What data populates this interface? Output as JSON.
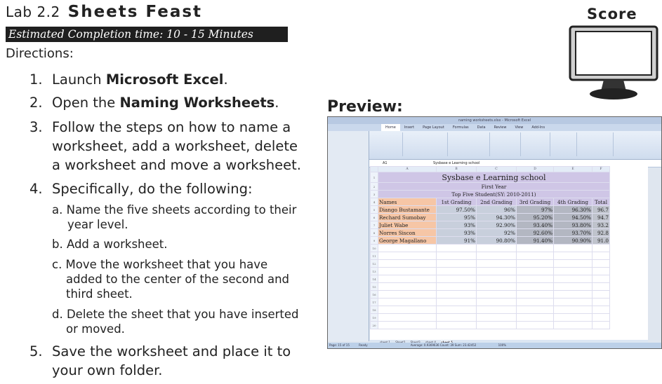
{
  "lab_prefix": "Lab 2.2",
  "lab_title": "Sheets Feast",
  "estimated": "Estimated Completion time: 10 - 15 Minutes",
  "directions_label": "Directions:",
  "steps": [
    {
      "num": "1.",
      "pre": "Launch ",
      "bold": "Microsoft Excel",
      "post": "."
    },
    {
      "num": "2.",
      "pre": "Open the ",
      "bold": "Naming Worksheets",
      "post": "."
    },
    {
      "num": "3.",
      "lines": [
        "Follow the steps on how to name a",
        "worksheet, add a worksheet, delete",
        "a  worksheet and move a worksheet."
      ]
    },
    {
      "num": "4.",
      "text": "Specifically, do the following:"
    },
    {
      "num": "5.",
      "lines": [
        "Save the worksheet and place it to",
        "your own folder."
      ]
    }
  ],
  "substeps": [
    {
      "lines": [
        "a. Name the five sheets according to their",
        "year level."
      ]
    },
    {
      "lines": [
        "b. Add a worksheet."
      ]
    },
    {
      "lines": [
        "c. Move the worksheet that you have",
        "added to the center of the second and",
        "third sheet."
      ]
    },
    {
      "lines": [
        "d. Delete the sheet that you have  inserted",
        "or moved."
      ]
    }
  ],
  "score_label": "Score",
  "preview_label": "Preview:",
  "excel": {
    "window_title": "naming worksheets.xlsx - Microsoft Excel",
    "tabs": [
      "Home",
      "Insert",
      "Page Layout",
      "Formulas",
      "Data",
      "Review",
      "View",
      "Add-Ins"
    ],
    "cell_ref": "A1",
    "formula": "Sysbase e Learning school",
    "columns": [
      "A",
      "B",
      "C",
      "D",
      "E",
      "F"
    ],
    "sheet_title": "Sysbase e Learning school",
    "sheet_subtitle": "First Year",
    "sheet_heading": "Top Five Student(SY: 2010-2011)",
    "headers": [
      "Names",
      "1st Grading",
      "2nd Grading",
      "3rd Grading",
      "4th Grading",
      "Total"
    ],
    "rows": [
      [
        "Diango Bustamante",
        "97.50%",
        "96%",
        "97%",
        "96.30%",
        "96.7"
      ],
      [
        "Rechard Sumobay",
        "95%",
        "94.30%",
        "95.20%",
        "94.50%",
        "94.7"
      ],
      [
        "Juliet Wabe",
        "93%",
        "92.90%",
        "93.40%",
        "93.80%",
        "93.2"
      ],
      [
        "Norres Siscon",
        "93%",
        "92%",
        "92.60%",
        "93.70%",
        "92.8"
      ],
      [
        "George Magallano",
        "91%",
        "90.80%",
        "91.40%",
        "90.90%",
        "91.0"
      ]
    ],
    "sheet_tabs": [
      "sheet 1",
      "Sheet2",
      "Sheet3",
      "sheet 4",
      "sheet 5"
    ],
    "status_ready": "Ready",
    "status_page": "Page: 15 of 15",
    "status_stats": "Average: 0.9369636   Count: 39   Sum: 23.42452",
    "zoom": "100%"
  }
}
